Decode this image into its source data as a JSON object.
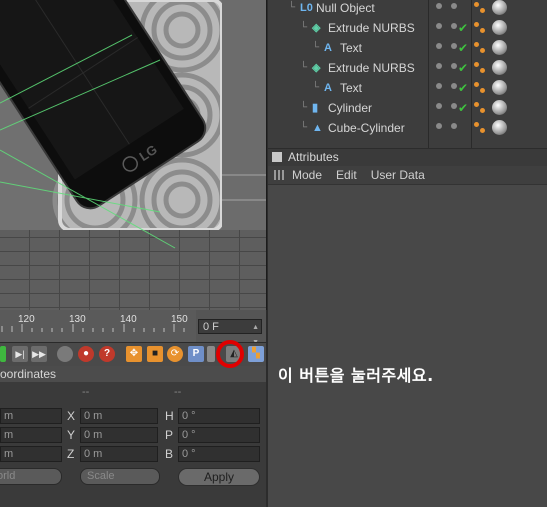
{
  "timeline": {
    "ticks": [
      "120",
      "130",
      "140",
      "150"
    ],
    "frame": "0 F"
  },
  "viewport": {
    "phone_logo": "LG"
  },
  "coordinates": {
    "title": "oordinates",
    "headers": [
      "--",
      "--"
    ],
    "position_axes": [
      "X",
      "Y",
      "Z"
    ],
    "size_axes": [
      "H",
      "P",
      "B"
    ],
    "position_values": [
      "0 m",
      "0 m",
      "0 m"
    ],
    "left_values": [
      "m",
      "m",
      "m"
    ],
    "rotation_values": [
      "0 °",
      "0 °",
      "0 °"
    ],
    "mode_dropdown": "orld",
    "scale_dropdown": "Scale",
    "apply_label": "Apply"
  },
  "objects": {
    "items": [
      {
        "name": "Null Object",
        "icon": "null-icon",
        "indent": 1
      },
      {
        "name": "Extrude NURBS",
        "icon": "extrude-icon",
        "indent": 2
      },
      {
        "name": "Text",
        "icon": "text-spline-icon",
        "indent": 3
      },
      {
        "name": "Extrude NURBS",
        "icon": "extrude-icon",
        "indent": 2
      },
      {
        "name": "Text",
        "icon": "text-spline-icon",
        "indent": 3
      },
      {
        "name": "Cylinder",
        "icon": "cylinder-icon",
        "indent": 2
      },
      {
        "name": "Cube-Cylinder",
        "icon": "boole-icon",
        "indent": 2
      }
    ]
  },
  "attributes": {
    "title": "Attributes",
    "menu": [
      "Mode",
      "Edit",
      "User Data"
    ]
  },
  "annotation": {
    "text": "이 버튼을 눌러주세요."
  },
  "colors": {
    "annotation_circle": "#e00000",
    "check_green": "#3fc23f",
    "spline_cyan": "#4ab0d8"
  }
}
